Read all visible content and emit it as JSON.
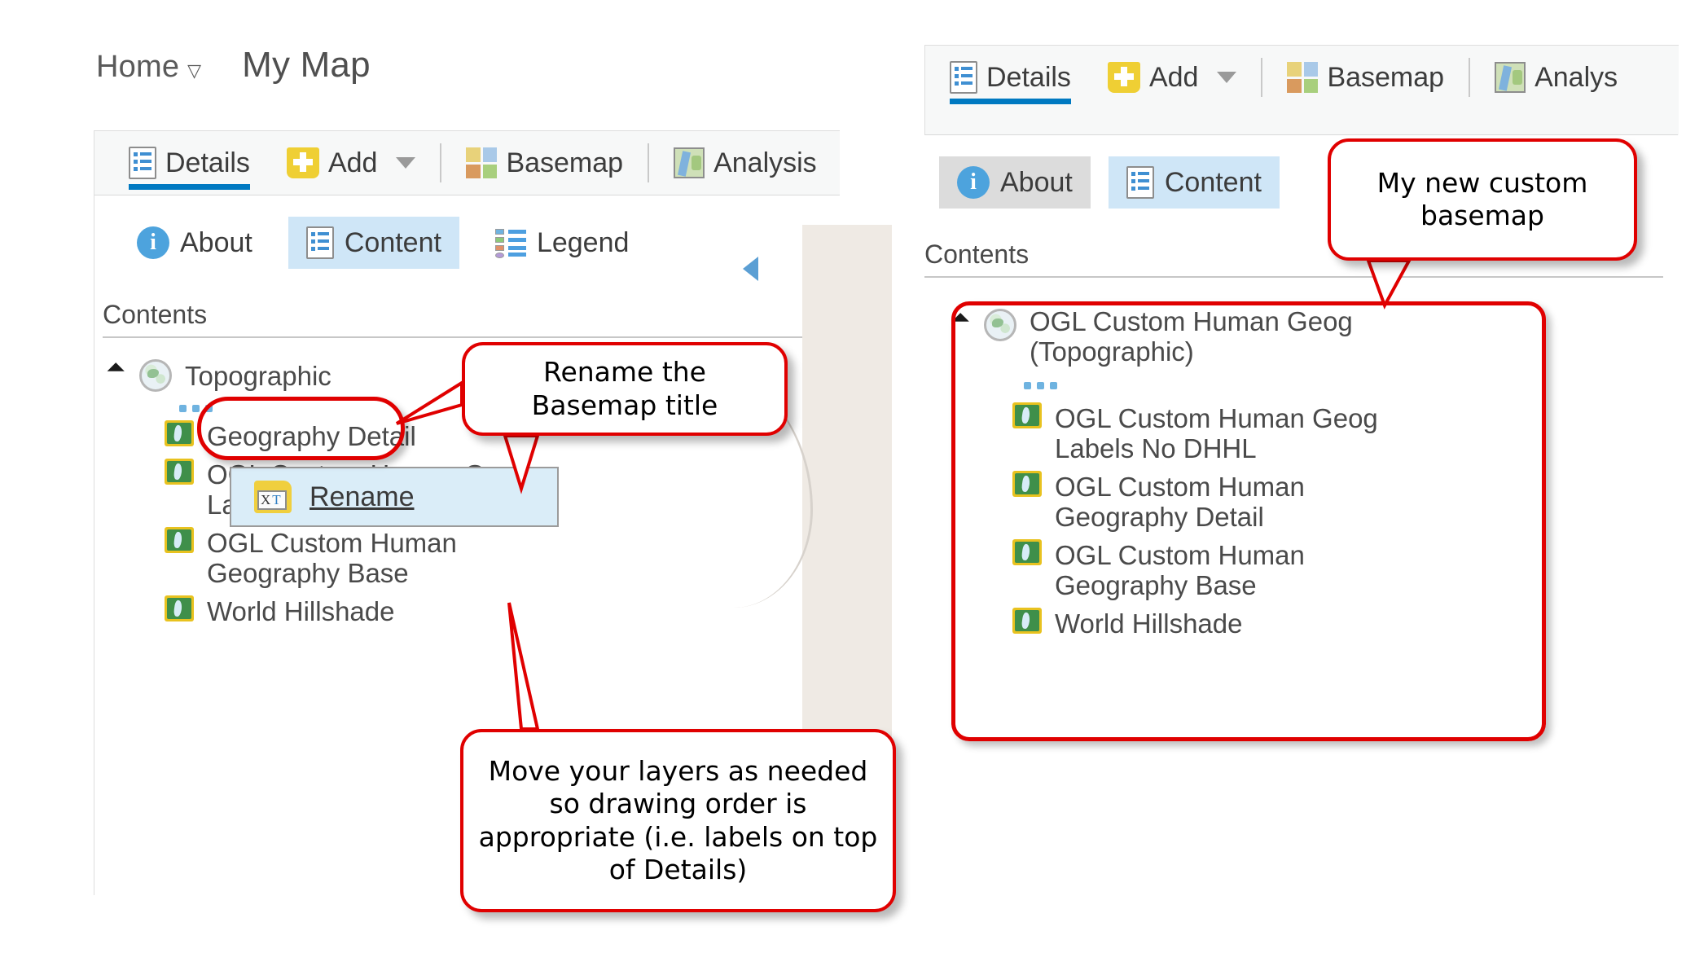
{
  "header": {
    "home_label": "Home",
    "home_caret": "chevron-down-icon",
    "map_title": "My Map"
  },
  "left_panel": {
    "toolbar": [
      {
        "label": "Details",
        "icon": "details-icon",
        "selected": true
      },
      {
        "label": "Add",
        "icon": "add-icon",
        "has_caret": true
      },
      {
        "label": "Basemap",
        "icon": "basemap-icon"
      },
      {
        "label": "Analysis",
        "icon": "analysis-icon"
      }
    ],
    "subtabs": [
      {
        "label": "About",
        "icon": "info-icon",
        "state": "normal"
      },
      {
        "label": "Content",
        "icon": "content-icon",
        "state": "selected"
      },
      {
        "label": "Legend",
        "icon": "legend-icon",
        "state": "normal"
      }
    ],
    "contents_label": "Contents",
    "basemap_group": "Topographic",
    "layers": [
      "Geography Detail",
      "OGL Custom Human Geog Labels No DHHL",
      "OGL Custom Human Geography Base",
      "World Hillshade"
    ],
    "context_menu": {
      "item_label": "Rename",
      "icon": "rename-icon",
      "icon_text_x": "X",
      "icon_text_t": "T"
    }
  },
  "right_panel": {
    "toolbar": [
      {
        "label": "Details",
        "icon": "details-icon",
        "selected": true
      },
      {
        "label": "Add",
        "icon": "add-icon",
        "has_caret": true
      },
      {
        "label": "Basemap",
        "icon": "basemap-icon"
      },
      {
        "label": "Analys",
        "icon": "analysis-icon"
      }
    ],
    "subtabs": [
      {
        "label": "About",
        "icon": "info-icon",
        "state": "grey"
      },
      {
        "label": "Content",
        "icon": "content-icon",
        "state": "selected"
      }
    ],
    "contents_label": "Contents",
    "basemap_group_line1": "OGL Custom Human Geog",
    "basemap_group_line2": "(Topographic)",
    "layers": [
      "OGL Custom Human Geog Labels No DHHL",
      "OGL Custom Human Geography Detail",
      "OGL Custom Human Geography Base",
      "World Hillshade"
    ]
  },
  "callouts": {
    "rename_basemap": "Rename the Basemap title",
    "move_layers": "Move your layers as needed so drawing order is appropriate (i.e. labels on top of Details)",
    "new_custom_basemap": "My new custom basemap"
  },
  "colors": {
    "accent_blue": "#0079c1",
    "selection_blue": "#cfe6f7",
    "annotation_red": "#e00000",
    "text_grey": "#4a4a4a",
    "panel_grey": "#f7f8f8"
  }
}
